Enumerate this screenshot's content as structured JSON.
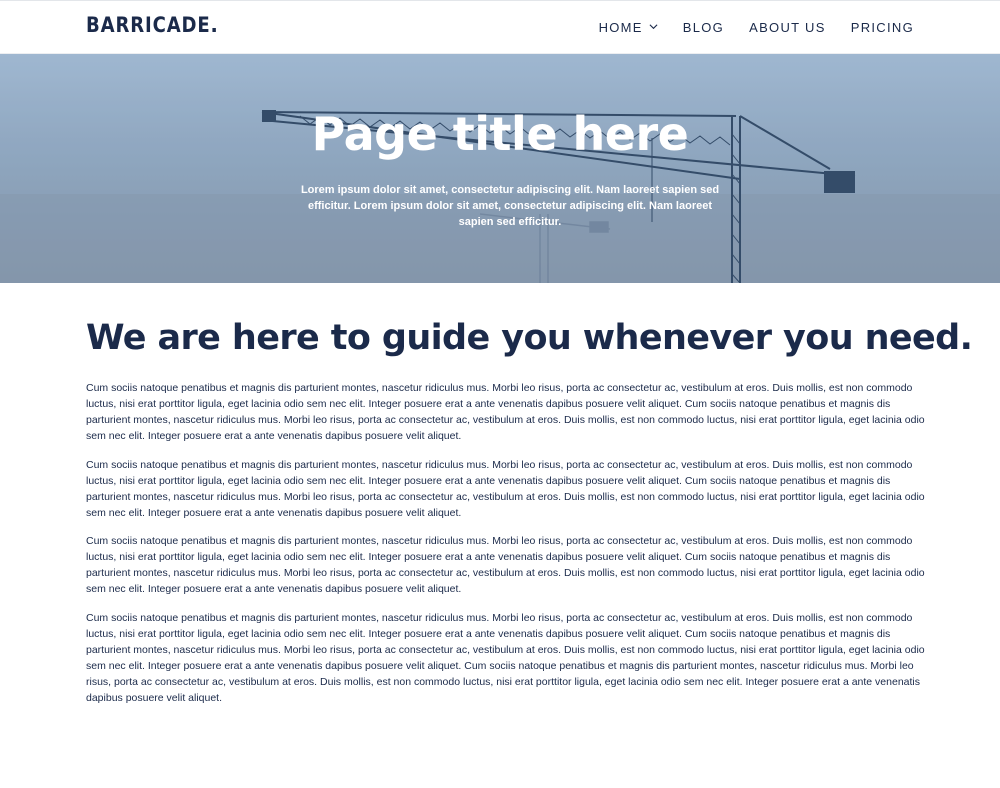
{
  "header": {
    "logo": "BARRICADE",
    "nav": [
      {
        "label": "HOME"
      },
      {
        "label": "BLOG"
      },
      {
        "label": "ABOUT US"
      },
      {
        "label": "PRICING"
      }
    ]
  },
  "hero": {
    "title": "Page title here",
    "subtitle": "Lorem ipsum dolor sit amet, consectetur adipiscing elit. Nam laoreet sapien sed efficitur. Lorem ipsum dolor sit amet, consectetur adipiscing elit. Nam laoreet sapien sed efficitur."
  },
  "main": {
    "heading": "We are here to guide you whenever you need.",
    "paragraphs": [
      "Cum sociis natoque penatibus et magnis dis parturient montes, nascetur ridiculus mus. Morbi leo risus, porta ac consectetur ac, vestibulum at eros. Duis mollis, est non commodo luctus, nisi erat porttitor ligula, eget lacinia odio sem nec elit. Integer posuere erat a ante venenatis dapibus posuere velit aliquet. Cum sociis natoque penatibus et magnis dis parturient montes, nascetur ridiculus mus. Morbi leo risus, porta ac consectetur ac, vestibulum at eros. Duis mollis, est non commodo luctus, nisi erat porttitor ligula, eget lacinia odio sem nec elit. Integer posuere erat a ante venenatis dapibus posuere velit aliquet.",
      "Cum sociis natoque penatibus et magnis dis parturient montes, nascetur ridiculus mus. Morbi leo risus, porta ac consectetur ac, vestibulum at eros. Duis mollis, est non commodo luctus, nisi erat porttitor ligula, eget lacinia odio sem nec elit. Integer posuere erat a ante venenatis dapibus posuere velit aliquet. Cum sociis natoque penatibus et magnis dis parturient montes, nascetur ridiculus mus. Morbi leo risus, porta ac consectetur ac, vestibulum at eros. Duis mollis, est non commodo luctus, nisi erat porttitor ligula, eget lacinia odio sem nec elit. Integer posuere erat a ante venenatis dapibus posuere velit aliquet.",
      "Cum sociis natoque penatibus et magnis dis parturient montes, nascetur ridiculus mus. Morbi leo risus, porta ac consectetur ac, vestibulum at eros. Duis mollis, est non commodo luctus, nisi erat porttitor ligula, eget lacinia odio sem nec elit. Integer posuere erat a ante venenatis dapibus posuere velit aliquet. Cum sociis natoque penatibus et magnis dis parturient montes, nascetur ridiculus mus. Morbi leo risus, porta ac consectetur ac, vestibulum at eros. Duis mollis, est non commodo luctus, nisi erat porttitor ligula, eget lacinia odio sem nec elit. Integer posuere erat a ante venenatis dapibus posuere velit aliquet.",
      "Cum sociis natoque penatibus et magnis dis parturient montes, nascetur ridiculus mus. Morbi leo risus, porta ac consectetur ac, vestibulum at eros. Duis mollis, est non commodo luctus, nisi erat porttitor ligula, eget lacinia odio sem nec elit. Integer posuere erat a ante venenatis dapibus posuere velit aliquet. Cum sociis natoque penatibus et magnis dis parturient montes, nascetur ridiculus mus. Morbi leo risus, porta ac consectetur ac, vestibulum at eros. Duis mollis, est non commodo luctus, nisi erat porttitor ligula, eget lacinia odio sem nec elit. Integer posuere erat a ante venenatis dapibus posuere velit aliquet. Cum sociis natoque penatibus et magnis dis parturient montes, nascetur ridiculus mus. Morbi leo risus, porta ac consectetur ac, vestibulum at eros. Duis mollis, est non commodo luctus, nisi erat porttitor ligula, eget lacinia odio sem nec elit. Integer posuere erat a ante venenatis dapibus posuere velit aliquet."
    ]
  },
  "icons": {
    "home_dropdown": "chevron-down-icon"
  },
  "colors": {
    "brand_navy": "#1b2a4a",
    "hero_sky": "#a9c0d8",
    "background": "#ffffff"
  }
}
